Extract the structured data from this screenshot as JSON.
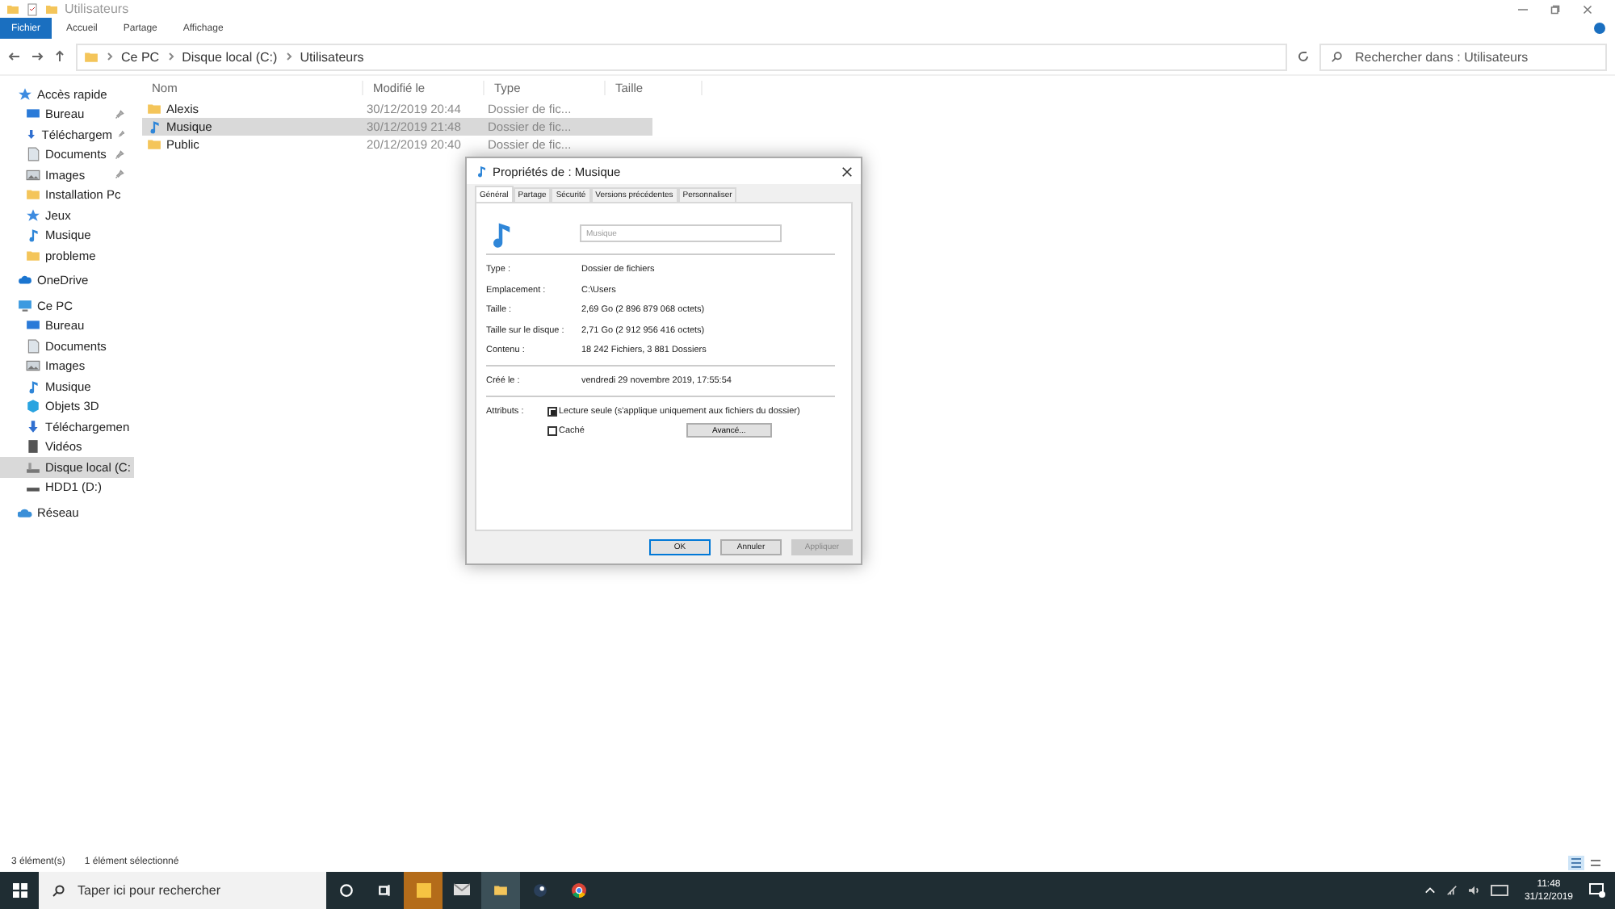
{
  "window": {
    "title": "Utilisateurs"
  },
  "ribbon_tabs": [
    {
      "label": "Fichier",
      "selected": true
    },
    {
      "label": "Accueil",
      "selected": false
    },
    {
      "label": "Partage",
      "selected": false
    },
    {
      "label": "Affichage",
      "selected": false
    }
  ],
  "breadcrumb": [
    "Ce PC",
    "Disque local (C:)",
    "Utilisateurs"
  ],
  "search": {
    "placeholder": "Rechercher dans : Utilisateurs"
  },
  "sidebar": {
    "items": [
      {
        "label": "Accès rapide",
        "kind": "star",
        "selected": false,
        "children": [
          {
            "label": "Bureau",
            "kind": "desktop",
            "pinned": true,
            "selected": false
          },
          {
            "label": "Téléchargem",
            "kind": "download",
            "pinned": true,
            "selected": false
          },
          {
            "label": "Documents",
            "kind": "document",
            "pinned": true,
            "selected": false
          },
          {
            "label": "Images",
            "kind": "image",
            "pinned": true,
            "selected": false
          },
          {
            "label": "Installation Pc",
            "kind": "folder",
            "pinned": false,
            "selected": false
          },
          {
            "label": "Jeux",
            "kind": "star",
            "pinned": false,
            "selected": false
          },
          {
            "label": "Musique",
            "kind": "music",
            "pinned": false,
            "selected": false
          },
          {
            "label": "probleme",
            "kind": "folder",
            "pinned": false,
            "selected": false
          }
        ]
      },
      {
        "label": "OneDrive",
        "kind": "cloud",
        "selected": false
      },
      {
        "label": "Ce PC",
        "kind": "pc",
        "selected": false,
        "children": [
          {
            "label": "Bureau",
            "kind": "desktop",
            "pinned": false,
            "selected": false
          },
          {
            "label": "Documents",
            "kind": "document",
            "pinned": false,
            "selected": false
          },
          {
            "label": "Images",
            "kind": "image",
            "pinned": false,
            "selected": false
          },
          {
            "label": "Musique",
            "kind": "music",
            "pinned": false,
            "selected": false
          },
          {
            "label": "Objets 3D",
            "kind": "cube",
            "pinned": false,
            "selected": false
          },
          {
            "label": "Téléchargemen",
            "kind": "download",
            "pinned": false,
            "selected": false
          },
          {
            "label": "Vidéos",
            "kind": "video",
            "pinned": false,
            "selected": false
          },
          {
            "label": "Disque local (C:",
            "kind": "drive",
            "pinned": false,
            "selected": true
          },
          {
            "label": "HDD1 (D:)",
            "kind": "hdd",
            "pinned": false,
            "selected": false
          }
        ]
      },
      {
        "label": "Réseau",
        "kind": "network",
        "selected": false
      }
    ]
  },
  "table": {
    "columns": [
      "Nom",
      "Modifié le",
      "Type",
      "Taille"
    ],
    "rows": [
      {
        "name": "Alexis",
        "modified": "30/12/2019 20:44",
        "type": "Dossier de fic...",
        "kind": "folder",
        "selected": false
      },
      {
        "name": "Musique",
        "modified": "30/12/2019 21:48",
        "type": "Dossier de fic...",
        "kind": "music",
        "selected": true
      },
      {
        "name": "Public",
        "modified": "20/12/2019 20:40",
        "type": "Dossier de fic...",
        "kind": "folder",
        "selected": false
      }
    ]
  },
  "status_bar": {
    "count": "3 élément(s)",
    "selection": "1 élément sélectionné"
  },
  "dialog": {
    "title": "Propriétés de : Musique",
    "tabs": [
      {
        "label": "Général",
        "selected": true
      },
      {
        "label": "Partage",
        "selected": false
      },
      {
        "label": "Sécurité",
        "selected": false
      },
      {
        "label": "Versions précédentes",
        "selected": false
      },
      {
        "label": "Personnaliser",
        "selected": false
      }
    ],
    "name_field": {
      "value": "Musique",
      "disabled": true
    },
    "properties": [
      {
        "label": "Type :",
        "value": "Dossier de fichiers"
      },
      {
        "label": "Emplacement :",
        "value": "C:\\Users"
      },
      {
        "label": "Taille :",
        "value": "2,69 Go (2 896 879 068 octets)"
      },
      {
        "label": "Taille sur le disque :",
        "value": "2,71 Go (2 912 956 416 octets)"
      },
      {
        "label": "Contenu :",
        "value": "18 242 Fichiers, 3 881 Dossiers"
      }
    ],
    "created": {
      "label": "Créé le :",
      "value": "vendredi 29 novembre 2019, 17:55:54"
    },
    "attributes_label": "Attributs :",
    "attributes": [
      {
        "label": "Lecture seule (s'applique uniquement aux fichiers du dossier)",
        "checked": true
      },
      {
        "label": "Caché",
        "checked": false
      }
    ],
    "advanced_button": "Avancé...",
    "buttons": [
      {
        "label": "OK",
        "disabled": false,
        "default": true
      },
      {
        "label": "Annuler",
        "disabled": false,
        "default": false
      },
      {
        "label": "Appliquer",
        "disabled": true,
        "default": false
      }
    ]
  },
  "taskbar": {
    "search_placeholder": "Taper ici pour rechercher",
    "time": "11:48",
    "date": "31/12/2019"
  }
}
